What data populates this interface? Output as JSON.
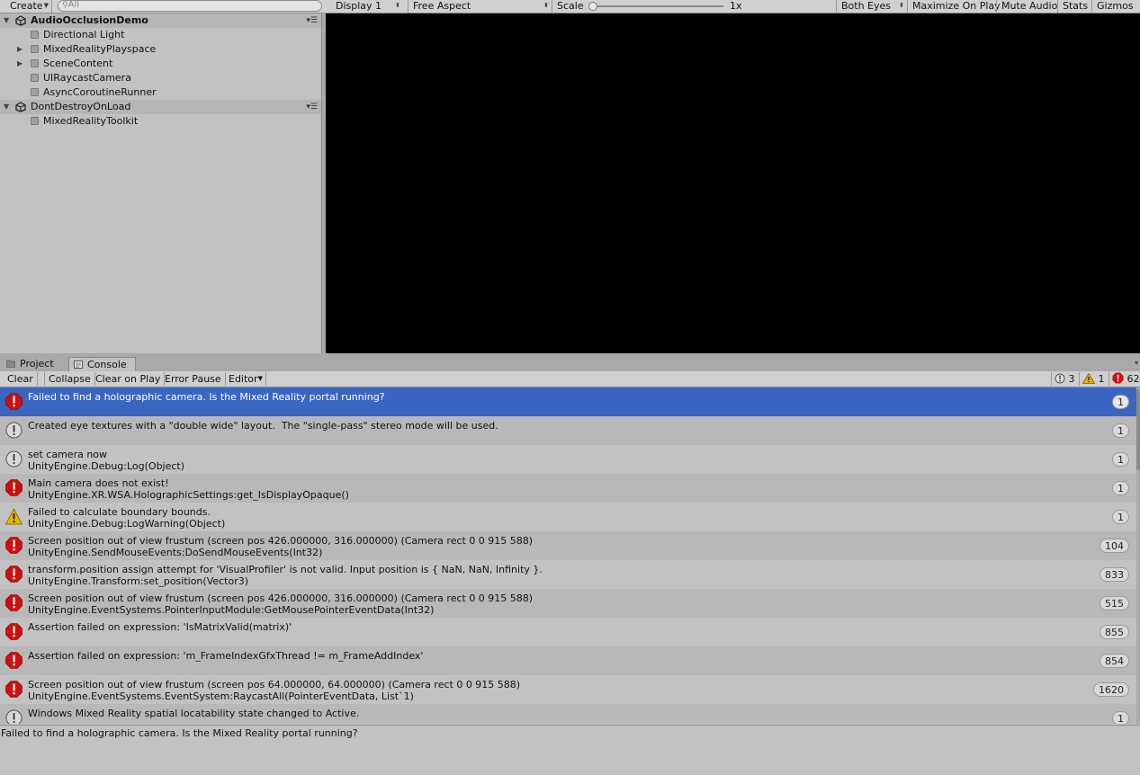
{
  "hierarchy": {
    "create_label": "Create",
    "search_placeholder": "All",
    "scenes": [
      {
        "name": "AudioOcclusionDemo",
        "children": [
          "Directional Light",
          "MixedRealityPlayspace",
          "SceneContent",
          "UIRaycastCamera",
          "AsyncCoroutineRunner"
        ]
      },
      {
        "name": "DontDestroyOnLoad",
        "children": [
          "MixedRealityToolkit"
        ]
      }
    ]
  },
  "game_toolbar": {
    "display": "Display 1",
    "aspect": "Free Aspect",
    "scale_label": "Scale",
    "scale_value": "1x",
    "both_eyes": "Both Eyes",
    "maximize": "Maximize On Play",
    "mute": "Mute Audio",
    "stats": "Stats",
    "gizmos": "Gizmos"
  },
  "console": {
    "tabs": [
      {
        "label": "Project",
        "icon": "folder-icon"
      },
      {
        "label": "Console",
        "icon": "console-icon"
      }
    ],
    "toolbar": {
      "clear": "Clear",
      "collapse": "Collapse",
      "clear_on_play": "Clear on Play",
      "error_pause": "Error Pause",
      "editor": "Editor"
    },
    "counts": {
      "info": "3",
      "warning": "1",
      "error": "62"
    },
    "logs": [
      {
        "type": "error",
        "line1": "Failed to find a holographic camera. Is the Mixed Reality portal running?",
        "line2": "",
        "count": "1",
        "selected": true
      },
      {
        "type": "info",
        "line1": "Created eye textures with a \"double wide\" layout.  The \"single-pass\" stereo mode will be used.",
        "line2": "",
        "count": "1"
      },
      {
        "type": "info",
        "line1": "set camera now",
        "line2": "UnityEngine.Debug:Log(Object)",
        "count": "1"
      },
      {
        "type": "error",
        "line1": "Main camera does not exist!",
        "line2": "UnityEngine.XR.WSA.HolographicSettings:get_IsDisplayOpaque()",
        "count": "1"
      },
      {
        "type": "warning",
        "line1": "Failed to calculate boundary bounds.",
        "line2": "UnityEngine.Debug:LogWarning(Object)",
        "count": "1"
      },
      {
        "type": "error",
        "line1": "Screen position out of view frustum (screen pos 426.000000, 316.000000) (Camera rect 0 0 915 588)",
        "line2": "UnityEngine.SendMouseEvents:DoSendMouseEvents(Int32)",
        "count": "104"
      },
      {
        "type": "error",
        "line1": "transform.position assign attempt for 'VisualProfiler' is not valid. Input position is { NaN, NaN, Infinity }.",
        "line2": "UnityEngine.Transform:set_position(Vector3)",
        "count": "833"
      },
      {
        "type": "error",
        "line1": "Screen position out of view frustum (screen pos 426.000000, 316.000000) (Camera rect 0 0 915 588)",
        "line2": "UnityEngine.EventSystems.PointerInputModule:GetMousePointerEventData(Int32)",
        "count": "515"
      },
      {
        "type": "error",
        "line1": "Assertion failed on expression: 'IsMatrixValid(matrix)'",
        "line2": "",
        "count": "855"
      },
      {
        "type": "error",
        "line1": "Assertion failed on expression: 'm_FrameIndexGfxThread != m_FrameAddIndex'",
        "line2": "",
        "count": "854"
      },
      {
        "type": "error",
        "line1": "Screen position out of view frustum (screen pos 64.000000, 64.000000) (Camera rect 0 0 915 588)",
        "line2": "UnityEngine.EventSystems.EventSystem:RaycastAll(PointerEventData, List`1)",
        "count": "1620"
      },
      {
        "type": "info",
        "line1": "Windows Mixed Reality spatial locatability state changed to Active.",
        "line2": "",
        "count": "1"
      }
    ],
    "detail": "Failed to find a holographic camera. Is the Mixed Reality portal running?"
  },
  "colors": {
    "selection": "#3a66c2",
    "error": "#cc1010",
    "warning": "#e8b400"
  }
}
